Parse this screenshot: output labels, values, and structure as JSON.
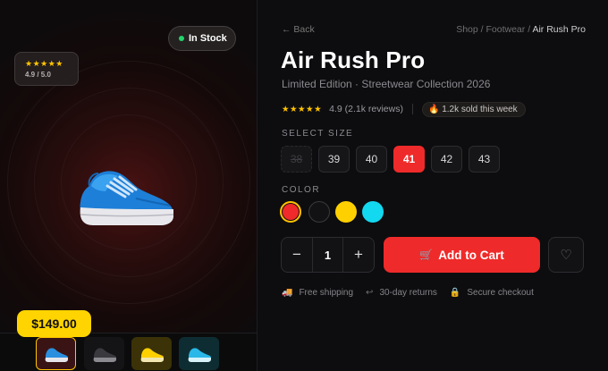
{
  "gallery": {
    "rating_stars": "★★★★★",
    "rating_score": "4.9 / 5.0",
    "stock_status": "In Stock",
    "price": "$149.00",
    "main_image_icon": "sneaker-icon",
    "thumbnails": [
      {
        "icon": "sneaker-icon",
        "color": "#2b8fe0"
      },
      {
        "icon": "sneaker-icon",
        "color": "#3a3a3e"
      },
      {
        "icon": "sneaker-icon",
        "color": "#ffd000"
      },
      {
        "icon": "sneaker-icon",
        "color": "#2ab8e8"
      }
    ]
  },
  "nav": {
    "back_label": "← Back",
    "breadcrumb": [
      "Shop",
      "Footwear",
      "Air Rush Pro"
    ]
  },
  "product": {
    "title": "Air Rush Pro",
    "subtitle": "Limited Edition · Streetwear Collection 2026",
    "stars": "★★★★★",
    "reviews": "4.9 (2.1k reviews)",
    "sold": "🔥 1.2k sold this week"
  },
  "size": {
    "label": "SELECT SIZE",
    "options": [
      {
        "label": "38",
        "state": "disabled"
      },
      {
        "label": "39",
        "state": "normal"
      },
      {
        "label": "40",
        "state": "normal"
      },
      {
        "label": "41",
        "state": "selected"
      },
      {
        "label": "42",
        "state": "normal"
      },
      {
        "label": "43",
        "state": "normal"
      }
    ]
  },
  "color": {
    "label": "COLOR",
    "options": [
      {
        "hex": "#f02a2a",
        "selected": true
      },
      {
        "hex": "#121214",
        "selected": false
      },
      {
        "hex": "#ffd000",
        "selected": false
      },
      {
        "hex": "#12d8f0",
        "selected": false
      }
    ]
  },
  "cart": {
    "minus": "−",
    "quantity": "1",
    "plus": "+",
    "add_label": "Add to Cart",
    "cart_icon": "🛒",
    "favorite_icon": "♡"
  },
  "perks": [
    {
      "icon": "truck-icon",
      "glyph": "🚚",
      "label": "Free shipping"
    },
    {
      "icon": "return-icon",
      "glyph": "↩",
      "label": "30-day returns"
    },
    {
      "icon": "lock-icon",
      "glyph": "🔒",
      "label": "Secure checkout"
    }
  ],
  "colors": {
    "accent": "#ef2a2a",
    "star": "#ffc400",
    "price_badge": "#ffd400",
    "in_stock_dot": "#22d36a"
  }
}
